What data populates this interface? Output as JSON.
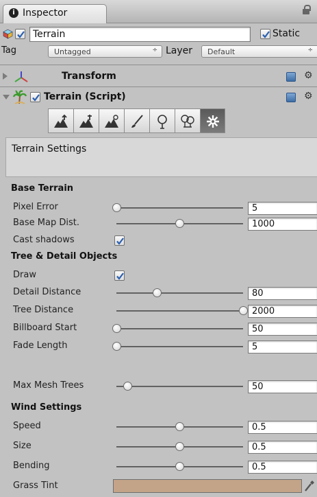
{
  "inspector": {
    "tab_label": "Inspector",
    "tab_icon_glyph": "i"
  },
  "object": {
    "name": "Terrain",
    "enabled": true,
    "static_label": "Static",
    "static": true
  },
  "tag_row": {
    "tag_label": "Tag",
    "tag_value": "Untagged",
    "layer_label": "Layer",
    "layer_value": "Default",
    "dropdown_arrow": "÷"
  },
  "components": [
    {
      "title": "Transform",
      "expanded": false
    },
    {
      "title": "Terrain (Script)",
      "expanded": true,
      "enabled": true
    }
  ],
  "toolbar": {
    "tools": [
      "raise-lower-icon",
      "set-height-icon",
      "smooth-height-icon",
      "paint-texture-icon",
      "place-trees-icon",
      "paint-details-icon",
      "terrain-settings-icon"
    ],
    "active_index": 6
  },
  "settings_box_label": "Terrain Settings",
  "sections": {
    "base": "Base Terrain",
    "tree": "Tree & Detail Objects",
    "wind": "Wind Settings"
  },
  "properties": {
    "pixel_error": {
      "label": "Pixel Error",
      "value": "5",
      "level": 0.0
    },
    "base_map_dist": {
      "label": "Base Map Dist.",
      "value": "1000",
      "level": 0.5
    },
    "cast_shadows": {
      "label": "Cast shadows",
      "checked": true
    },
    "draw": {
      "label": "Draw",
      "checked": true
    },
    "detail_distance": {
      "label": "Detail Distance",
      "value": "80",
      "level": 0.32
    },
    "tree_distance": {
      "label": "Tree Distance",
      "value": "2000",
      "level": 1.0
    },
    "billboard_start": {
      "label": "Billboard Start",
      "value": "50",
      "level": 0.0
    },
    "fade_length": {
      "label": "Fade Length",
      "value": "5",
      "level": 0.0
    },
    "max_mesh_trees": {
      "label": "Max Mesh Trees",
      "value": "50",
      "level": 0.09
    },
    "speed": {
      "label": "Speed",
      "value": "0.5",
      "level": 0.5
    },
    "size": {
      "label": "Size",
      "value": "0.5",
      "level": 0.5
    },
    "bending": {
      "label": "Bending",
      "value": "0.5",
      "level": 0.5
    },
    "grass_tint": {
      "label": "Grass Tint",
      "color": "#c3a488"
    }
  },
  "colors": {
    "panel_bg": "#c2c2c2",
    "active_tool": "#666666"
  }
}
